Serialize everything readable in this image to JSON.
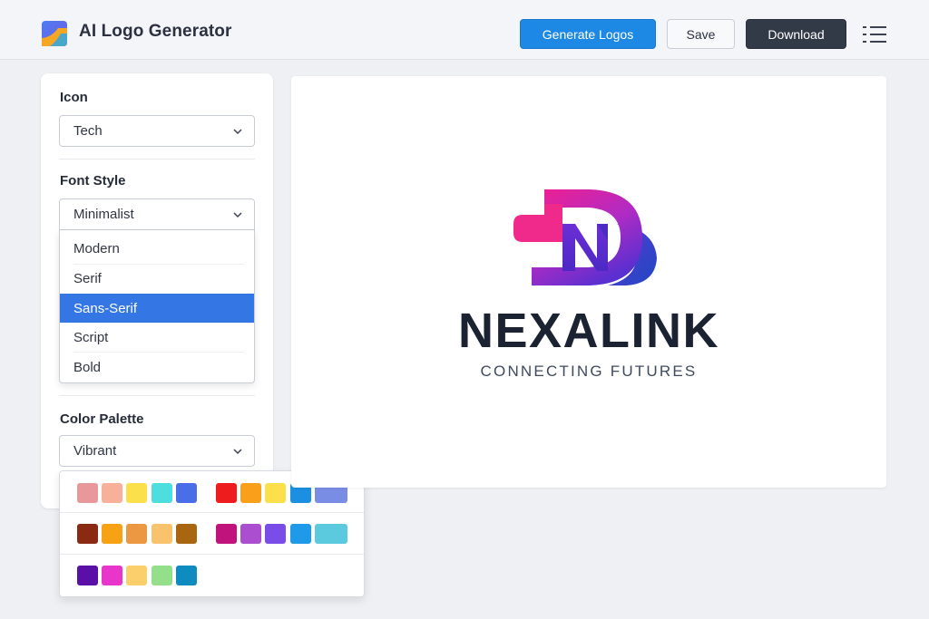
{
  "header": {
    "app_title": "AI Logo Generator",
    "app_icon": "app-logo-icon",
    "generate_label": "Generate Logos",
    "save_label": "Save",
    "download_label": "Download",
    "menu_icon": "list-menu-icon"
  },
  "sidebar": {
    "icon_label": "Icon",
    "icon_value": "Tech",
    "font_label": "Font Style",
    "font_value": "Minimalist",
    "font_options": [
      "Modern",
      "Serif",
      "Sans-Serif",
      "Script",
      "Bold"
    ],
    "font_highlighted": "Sans-Serif",
    "color_label": "Color Palette",
    "color_value": "Vibrant",
    "palette_rows": [
      [
        [
          "#e8979b",
          "#f7b19b",
          "#fbe04b",
          "#4ddfdf",
          "#4a6ee8"
        ],
        [
          "#ee1c1c",
          "#f9a01b",
          "#fbe04b",
          "#1b8fe0",
          "#7a8de4"
        ]
      ],
      [
        [
          "#8b2a12",
          "#f7a114",
          "#ec9843",
          "#f9c36d",
          "#a86611"
        ],
        [
          "#c0137b",
          "#ab4fd0",
          "#7a4ce8",
          "#1e9ae8",
          "#5bc9de"
        ]
      ],
      [
        [
          "#5a0fa6",
          "#e736c9",
          "#fbcf6b",
          "#94e08a",
          "#0e8cc0"
        ]
      ]
    ]
  },
  "preview": {
    "brand_name": "NEXALINK",
    "tagline": "CONNECTING FUTURES",
    "mark_icon": "nexalink-mark-icon",
    "colors": {
      "magenta": "#f21f8f",
      "purple": "#6b2fd6",
      "blue": "#2a4ec8"
    }
  }
}
